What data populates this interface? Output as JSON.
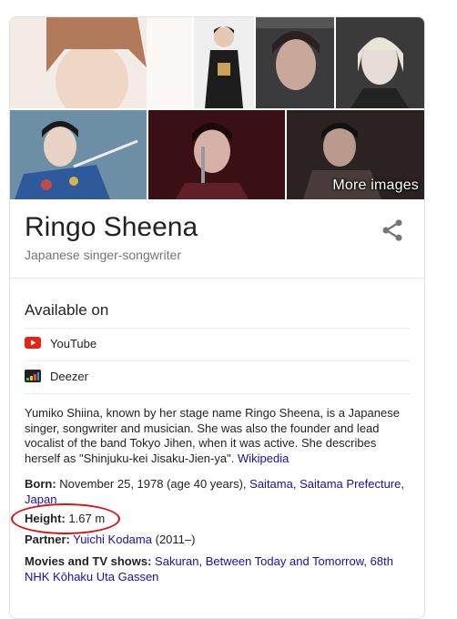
{
  "images": {
    "more_label": "More images"
  },
  "header": {
    "title": "Ringo Sheena",
    "subtitle": "Japanese singer-songwriter"
  },
  "available_on": {
    "heading": "Available on",
    "services": [
      {
        "label": "YouTube",
        "icon": "youtube-icon",
        "color": "#e62117"
      },
      {
        "label": "Deezer",
        "icon": "deezer-icon",
        "color": "#222222"
      }
    ]
  },
  "description": {
    "text": "Yumiko Shiina, known by her stage name Ringo Sheena, is a Japanese singer, songwriter and musician. She was also the founder and lead vocalist of the band Tokyo Jihen, when it was active. She describes herself as \"Shinjuku-kei Jisaku-Jien-ya\".",
    "source_link": "Wikipedia"
  },
  "facts": {
    "born": {
      "label": "Born:",
      "value": "November 25, 1978 (age 40 years),",
      "links": [
        "Saitama,",
        "Saitama Prefecture,",
        "Japan"
      ]
    },
    "height": {
      "label": "Height:",
      "value": "1.67 m"
    },
    "partner": {
      "label": "Partner:",
      "link": "Yuichi Kodama",
      "value": "(2011–)"
    },
    "movies": {
      "label": "Movies and TV shows:",
      "links": [
        "Sakuran,",
        "Between Today and Tomorrow,",
        "68th NHK Kōhaku Uta Gassen"
      ]
    }
  },
  "colors": {
    "link": "#1a0dab",
    "annotation": "#d81212",
    "muted": "#70757a"
  }
}
